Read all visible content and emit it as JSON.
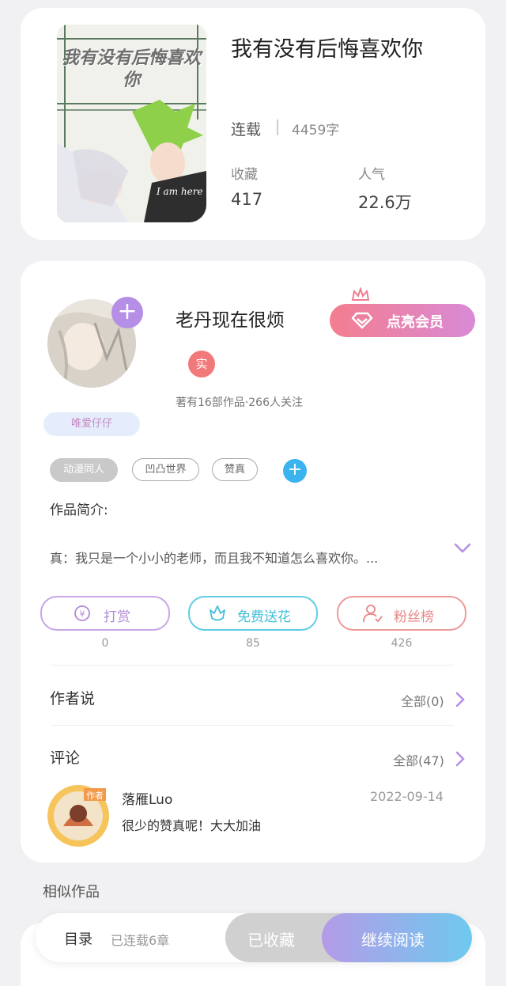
{
  "book": {
    "title": "我有没有后悔喜欢你",
    "cover_title": "我有没有后悔喜欢你",
    "cover_caption": "I am here",
    "status": "连载",
    "word_count": "4459字",
    "stats": [
      {
        "label": "收藏",
        "value": "417"
      },
      {
        "label": "人气",
        "value": "22.6万"
      }
    ]
  },
  "author": {
    "name": "老丹现在很烦",
    "verified_badge": "实",
    "meta": "著有16部作品·266人关注",
    "vip_button": "点亮会员",
    "fan_badge": "唯爱仔仔",
    "tags": [
      "动漫同人",
      "凹凸世界",
      "赞真"
    ]
  },
  "synopsis": {
    "label": "作品简介:",
    "text": "真：我只是一个小小的老师，而且我不知道怎么喜欢你。..."
  },
  "actions": [
    {
      "label": "打赏",
      "count": "0",
      "color": "#b38ad9"
    },
    {
      "label": "免费送花",
      "count": "85",
      "color": "#45bfd9"
    },
    {
      "label": "粉丝榜",
      "count": "426",
      "color": "#e98686"
    }
  ],
  "author_says": {
    "title": "作者说",
    "link": "全部(0)"
  },
  "comments": {
    "title": "评论",
    "link": "全部(47)",
    "items": [
      {
        "user": "落雁Luo",
        "date": "2022-09-14",
        "text": "很少的赞真呢！大大加油"
      }
    ]
  },
  "similar": {
    "title": "相似作品"
  },
  "bottom_bar": {
    "toc": "目录",
    "chapters": "已连载6章",
    "collected": "已收藏",
    "continue": "继续阅读"
  }
}
